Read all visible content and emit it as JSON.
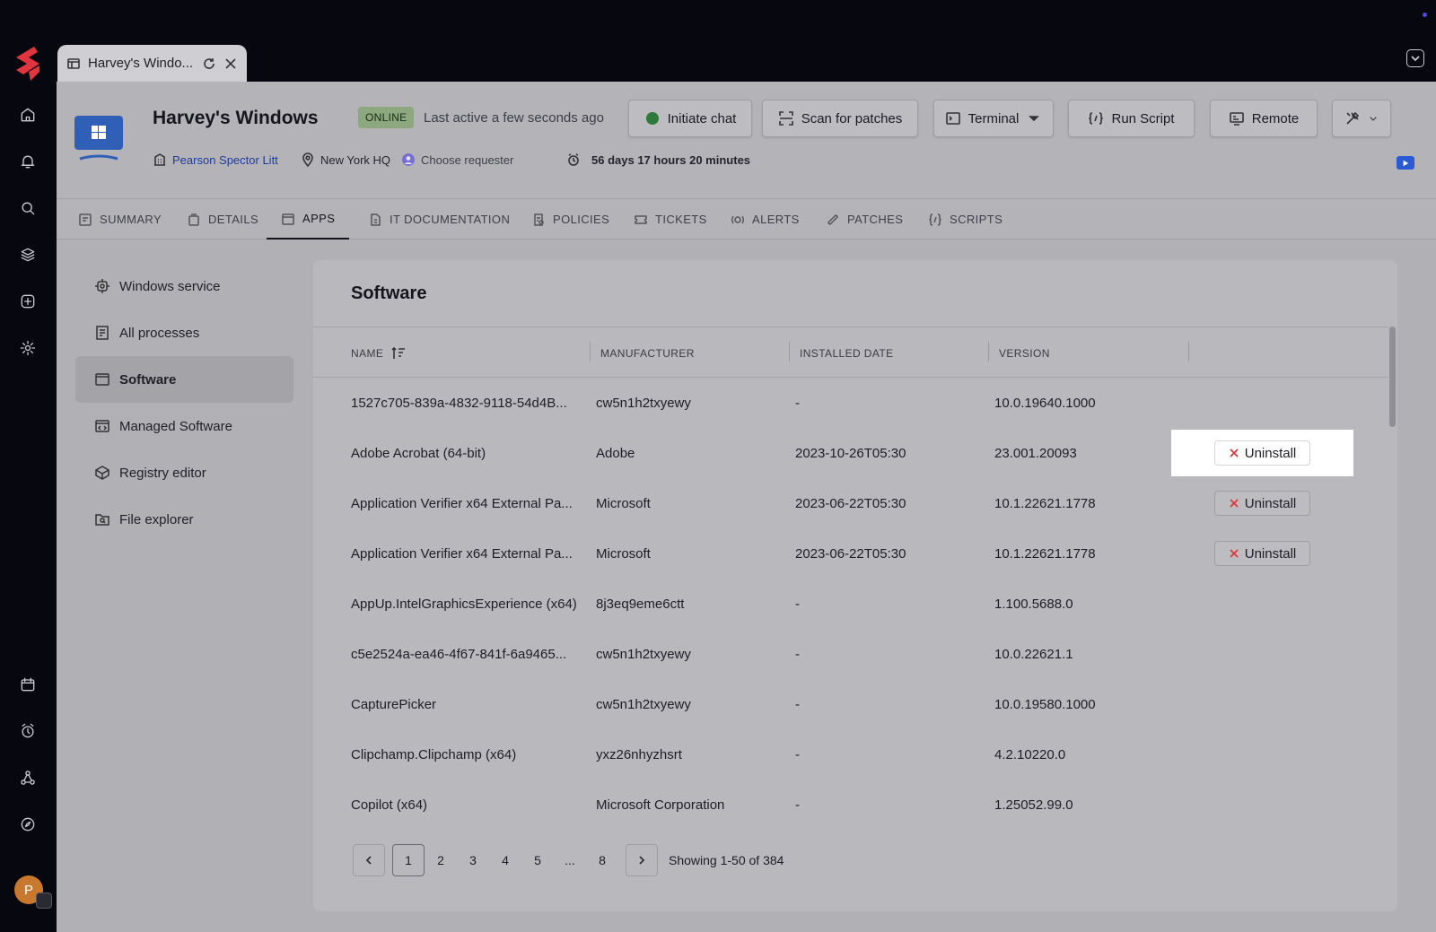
{
  "window": {
    "tab_title": "Harvey's Windo..."
  },
  "device": {
    "name": "Harvey's Windows",
    "status": "ONLINE",
    "last_active": "Last active a few seconds ago",
    "organization": "Pearson Spector Litt",
    "location": "New York HQ",
    "requester": "Choose requester",
    "uptime": "56 days 17 hours 20 minutes"
  },
  "actions": {
    "initiate_chat": "Initiate chat",
    "scan_patches": "Scan for patches",
    "terminal": "Terminal",
    "run_script": "Run Script",
    "remote": "Remote"
  },
  "tabs": [
    {
      "label": "SUMMARY"
    },
    {
      "label": "DETAILS"
    },
    {
      "label": "APPS"
    },
    {
      "label": "IT DOCUMENTATION"
    },
    {
      "label": "POLICIES"
    },
    {
      "label": "TICKETS"
    },
    {
      "label": "ALERTS"
    },
    {
      "label": "PATCHES"
    },
    {
      "label": "SCRIPTS"
    }
  ],
  "subnav": [
    {
      "label": "Windows service"
    },
    {
      "label": "All processes"
    },
    {
      "label": "Software"
    },
    {
      "label": "Managed Software"
    },
    {
      "label": "Registry editor"
    },
    {
      "label": "File explorer"
    }
  ],
  "software": {
    "title": "Software",
    "columns": {
      "name": "NAME",
      "manufacturer": "MANUFACTURER",
      "installed": "INSTALLED DATE",
      "version": "VERSION"
    },
    "uninstall_label": "Uninstall",
    "rows": [
      {
        "name": "1527c705-839a-4832-9118-54d4B...",
        "manufacturer": "cw5n1h2txyewy",
        "installed": "-",
        "version": "10.0.19640.1000"
      },
      {
        "name": "Adobe Acrobat (64-bit)",
        "manufacturer": "Adobe",
        "installed": "2023-10-26T05:30",
        "version": "23.001.20093"
      },
      {
        "name": "Application Verifier x64 External Pa...",
        "manufacturer": "Microsoft",
        "installed": "2023-06-22T05:30",
        "version": "10.1.22621.1778"
      },
      {
        "name": "Application Verifier x64 External Pa...",
        "manufacturer": "Microsoft",
        "installed": "2023-06-22T05:30",
        "version": "10.1.22621.1778"
      },
      {
        "name": "AppUp.IntelGraphicsExperience (x64)",
        "manufacturer": "8j3eq9eme6ctt",
        "installed": "-",
        "version": "1.100.5688.0"
      },
      {
        "name": "c5e2524a-ea46-4f67-841f-6a9465...",
        "manufacturer": "cw5n1h2txyewy",
        "installed": "-",
        "version": "10.0.22621.1"
      },
      {
        "name": "CapturePicker",
        "manufacturer": "cw5n1h2txyewy",
        "installed": "-",
        "version": "10.0.19580.1000"
      },
      {
        "name": "Clipchamp.Clipchamp (x64)",
        "manufacturer": "yxz26nhyzhsrt",
        "installed": "-",
        "version": "4.2.10220.0"
      },
      {
        "name": "Copilot (x64)",
        "manufacturer": "Microsoft Corporation",
        "installed": "-",
        "version": "1.25052.99.0"
      }
    ]
  },
  "pagination": {
    "pages": [
      "1",
      "2",
      "3",
      "4",
      "5",
      "...",
      "8"
    ],
    "current": "1",
    "summary": "Showing 1-50 of 384"
  }
}
